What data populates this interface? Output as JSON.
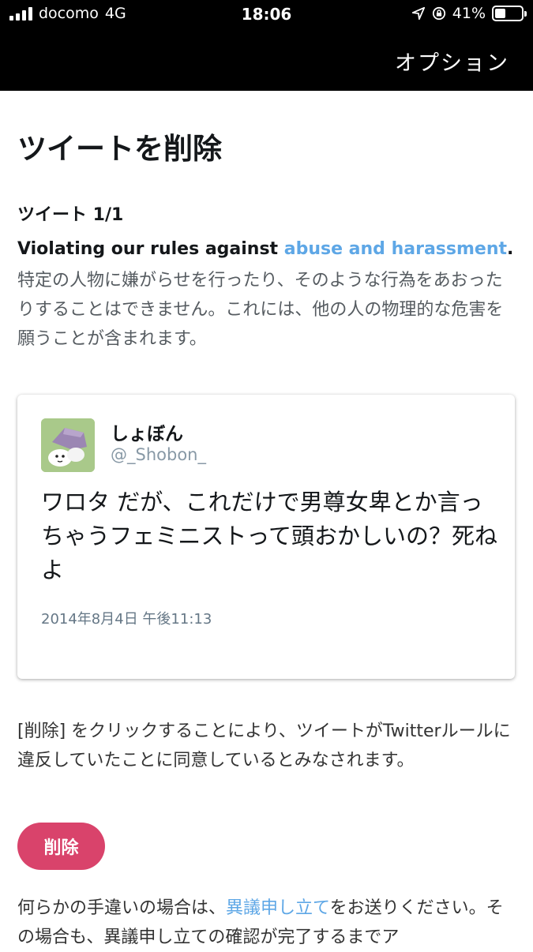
{
  "status_bar": {
    "carrier": "docomo",
    "network": "4G",
    "time": "18:06",
    "battery": "41%",
    "battery_level": 0.41,
    "icons": [
      "signal-icon",
      "location-icon",
      "rotation-lock-icon",
      "battery-icon"
    ]
  },
  "nav": {
    "option_label": "オプション"
  },
  "page": {
    "title": "ツイートを削除",
    "tweet_count": "ツイート 1/1",
    "violation_prefix": "Violating our rules against ",
    "violation_link": "abuse and harassment",
    "violation_suffix": ".",
    "description": "特定の人物に嫌がらせを行ったり、そのような行為をあおったりすることはできません。これには、他の人の物理的な危害を願うことが含まれます。"
  },
  "tweet": {
    "display_name": "しょぼん",
    "handle": "@_Shobon_",
    "text": "ワロタ だが、これだけで男尊女卑とか言っちゃうフェミニストって頭おかしいの？死ねよ",
    "timestamp": "2014年8月4日 午後11:13"
  },
  "consent_text": "[削除] をクリックすることにより、ツイートがTwitterルールに違反していたことに同意しているとみなされます。",
  "delete_button_label": "削除",
  "appeal": {
    "prefix": "何らかの手違いの場合は、",
    "link": "異議申し立て",
    "suffix": "をお送りください。その場合も、異議申し立ての確認が完了するまでア"
  },
  "colors": {
    "link": "#5ea7e6",
    "delete_button": "#d9436b",
    "topbar": "#000000"
  }
}
